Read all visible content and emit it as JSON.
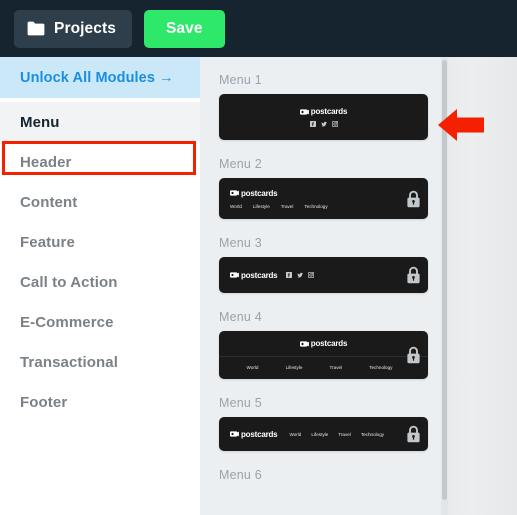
{
  "topbar": {
    "projects_button": "Projects",
    "projects_icon": "folder-icon",
    "save_button": "Save",
    "background_color": "#16242f",
    "projects_button_color": "#2e3f4b",
    "save_button_color": "#2ee86a"
  },
  "sidebar": {
    "unlock": {
      "label": "Unlock All Modules →",
      "text_color": "#1a8fe0",
      "background_color": "#cbe8f9"
    },
    "items": [
      {
        "label": "Menu",
        "active": true
      },
      {
        "label": "Header",
        "active": false
      },
      {
        "label": "Content",
        "active": false
      },
      {
        "label": "Feature",
        "active": false
      },
      {
        "label": "Call to Action",
        "active": false
      },
      {
        "label": "E-Commerce",
        "active": false
      },
      {
        "label": "Transactional",
        "active": false
      },
      {
        "label": "Footer",
        "active": false
      }
    ],
    "active_background_color": "#f1f3f4",
    "inactive_text_color": "#7b8186",
    "active_text_color": "#16242f"
  },
  "annotation": {
    "highlight_box_color": "#f42000",
    "highlight_target": "Menu",
    "arrow_color": "#f42000",
    "arrow_direction": "left",
    "arrow_points_at": "Menu 1"
  },
  "content": {
    "background_color": "#eceff1",
    "card_background_color": "#1a1a1a",
    "brand_name": "postcards",
    "lock_icon": "lock-icon",
    "templates": [
      {
        "title": "Menu 1",
        "layout": "centered-logo-social",
        "brand": "postcards",
        "social": [
          "facebook-icon",
          "twitter-icon",
          "instagram-icon"
        ],
        "links": [],
        "locked": false
      },
      {
        "title": "Menu 2",
        "layout": "left-logo-links-below",
        "brand": "postcards",
        "social": [],
        "links": [
          "World",
          "Lifestyle",
          "Travel",
          "Technology"
        ],
        "locked": true
      },
      {
        "title": "Menu 3",
        "layout": "inline-logo-social",
        "brand": "postcards",
        "social": [
          "facebook-icon",
          "twitter-icon",
          "instagram-icon"
        ],
        "links": [],
        "locked": true
      },
      {
        "title": "Menu 4",
        "layout": "centered-logo-divider-links",
        "brand": "postcards",
        "social": [],
        "links": [
          "World",
          "Lifestyle",
          "Travel",
          "Technology"
        ],
        "locked": true
      },
      {
        "title": "Menu 5",
        "layout": "inline-logo-links",
        "brand": "postcards",
        "social": [],
        "links": [
          "World",
          "Lifestyle",
          "Travel",
          "Technology"
        ],
        "locked": true
      },
      {
        "title": "Menu 6",
        "layout": "cut-off",
        "brand": "",
        "social": [],
        "links": [],
        "locked": false
      }
    ]
  },
  "scrollbar": {
    "orientation": "vertical",
    "track_color": "#e3e6e8",
    "thumb_color": "#c3c9cd"
  }
}
